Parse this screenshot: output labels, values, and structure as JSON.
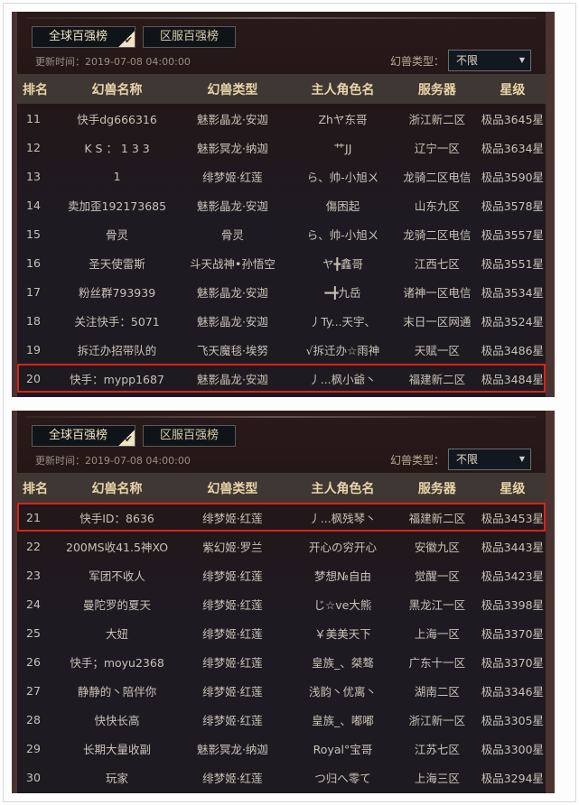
{
  "panels": [
    {
      "tabs": [
        {
          "label": "全球百强榜",
          "active": true
        },
        {
          "label": "区服百强榜",
          "active": false
        }
      ],
      "update_time": "更新时间：2019-07-08 04:00:00",
      "filter": {
        "label": "幻兽类型：",
        "value": "不限"
      },
      "columns": [
        "排名",
        "幻兽名称",
        "幻兽类型",
        "主人角色名",
        "服务器",
        "星级"
      ],
      "rows": [
        {
          "rank": "11",
          "name": "快手dg666316",
          "type": "魅影晶龙·安迦",
          "owner": "Zhヤ东哥",
          "server": "浙江新二区",
          "star": "极品3645星"
        },
        {
          "rank": "12",
          "name": "K S ： 1 3 3",
          "type": "魅影冥龙·纳迦",
          "owner": "艹JJ",
          "server": "辽宁一区",
          "star": "极品3634星"
        },
        {
          "rank": "13",
          "name": "1",
          "type": "绯梦姬·红莲",
          "owner": "ら、帅-小旭ㄨ",
          "server": "龙骑二区电信",
          "star": "极品3590星"
        },
        {
          "rank": "14",
          "name": "卖加歪192173685",
          "type": "魅影晶龙·安迦",
          "owner": "傷困起",
          "server": "山东九区",
          "star": "极品3578星"
        },
        {
          "rank": "15",
          "name": "骨灵",
          "type": "骨灵",
          "owner": "ら、帅-小旭ㄨ",
          "server": "龙骑二区电信",
          "star": "极品3557星"
        },
        {
          "rank": "16",
          "name": "圣天使雷斯",
          "type": "斗天战神•孙悟空",
          "owner": "ヤ╋鑫哥",
          "server": "江西七区",
          "star": "极品3551星"
        },
        {
          "rank": "17",
          "name": "粉丝群793939",
          "type": "魅影晶龙·安迦",
          "owner": "━╋九岳",
          "server": "诸神一区电信",
          "star": "极品3534星"
        },
        {
          "rank": "18",
          "name": "关注快手：5071",
          "type": "魅影晶龙·安迦",
          "owner": "丿Ty...天宇、",
          "server": "末日一区网通",
          "star": "极品3524星"
        },
        {
          "rank": "19",
          "name": "拆迁办招带队的",
          "type": "飞天魔毯·埃努",
          "owner": "√拆迁办☆雨神",
          "server": "天赋一区",
          "star": "极品3486星"
        },
        {
          "rank": "20",
          "name": "快手：mypp1687",
          "type": "魅影晶龙·安迦",
          "owner": "丿...枫小爺丶",
          "server": "福建新二区",
          "star": "极品3484星",
          "highlighted": true
        }
      ]
    },
    {
      "tabs": [
        {
          "label": "全球百强榜",
          "active": true
        },
        {
          "label": "区服百强榜",
          "active": false
        }
      ],
      "update_time": "更新时间：2019-07-08 04:00:00",
      "filter": {
        "label": "幻兽类型：",
        "value": "不限"
      },
      "columns": [
        "排名",
        "幻兽名称",
        "幻兽类型",
        "主人角色名",
        "服务器",
        "星级"
      ],
      "rows": [
        {
          "rank": "21",
          "name": "快手ID：8636",
          "type": "绯梦姬·红莲",
          "owner": "丿...枫残琴丶",
          "server": "福建新二区",
          "star": "极品3453星",
          "highlighted": true
        },
        {
          "rank": "22",
          "name": "200MS收41.5神XO",
          "type": "紫幻姬·罗兰",
          "owner": "开心の穷开心",
          "server": "安徽九区",
          "star": "极品3443星"
        },
        {
          "rank": "23",
          "name": "军团不收人",
          "type": "绯梦姬·红莲",
          "owner": "梦想№自由",
          "server": "觉醒一区",
          "star": "极品3423星"
        },
        {
          "rank": "24",
          "name": "曼陀罗的夏天",
          "type": "绯梦姬·红莲",
          "owner": "じ☆ve大熊",
          "server": "黑龙江一区",
          "star": "极品3398星"
        },
        {
          "rank": "25",
          "name": "大妞",
          "type": "绯梦姬·红莲",
          "owner": "￥美美天下",
          "server": "上海一区",
          "star": "极品3370星"
        },
        {
          "rank": "26",
          "name": "快手；moyu2368",
          "type": "绯梦姬·红莲",
          "owner": "皇族_、桀骜",
          "server": "广东十一区",
          "star": "极品3370星"
        },
        {
          "rank": "27",
          "name": "静静的丶陪伴你",
          "type": "绯梦姬·红莲",
          "owner": "浅韵丶优离丶",
          "server": "湖南二区",
          "star": "极品3346星"
        },
        {
          "rank": "28",
          "name": "快快长高",
          "type": "绯梦姬·红莲",
          "owner": "皇族_、嘟嘟",
          "server": "浙江新一区",
          "star": "极品3305星"
        },
        {
          "rank": "29",
          "name": "长期大量收副",
          "type": "魅影冥龙·纳迦",
          "owner": "Royal°宝哥",
          "server": "江苏七区",
          "star": "极品3300星"
        },
        {
          "rank": "30",
          "name": "玩家",
          "type": "绯梦姬·红莲",
          "owner": "つ归へ零て",
          "server": "上海三区",
          "star": "极品3294星"
        }
      ]
    }
  ],
  "colors": {
    "highlight_border": "#d8231c",
    "header_text": "#e9d5a8",
    "row_text": "#c9c2b6"
  }
}
